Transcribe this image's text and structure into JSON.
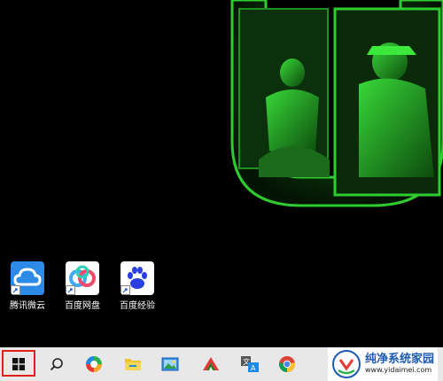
{
  "desktop": {
    "icons": [
      {
        "label": "腾讯微云",
        "icon": "weiyun-cloud-icon"
      },
      {
        "label": "百度网盘",
        "icon": "baidu-netdisk-icon"
      },
      {
        "label": "百度经验",
        "icon": "baidu-paw-icon"
      }
    ]
  },
  "taskbar": {
    "items": [
      {
        "name": "start-button",
        "icon": "windows-logo-icon"
      },
      {
        "name": "search-button",
        "icon": "search-icon"
      },
      {
        "name": "app-360-browser",
        "icon": "colorful-circle-icon"
      },
      {
        "name": "file-explorer",
        "icon": "folder-icon"
      },
      {
        "name": "app-image-viewer",
        "icon": "picture-icon"
      },
      {
        "name": "app-wps",
        "icon": "wps-icon"
      },
      {
        "name": "app-translator",
        "icon": "translate-icon"
      },
      {
        "name": "chrome",
        "icon": "chrome-icon"
      }
    ]
  },
  "watermark": {
    "title": "纯净系统家园",
    "url": "www.yidaimei.com"
  },
  "colors": {
    "taskbar_bg": "#e8e8e8",
    "highlight": "#e0201b",
    "wallpaper_green": "#2ecc2e"
  }
}
